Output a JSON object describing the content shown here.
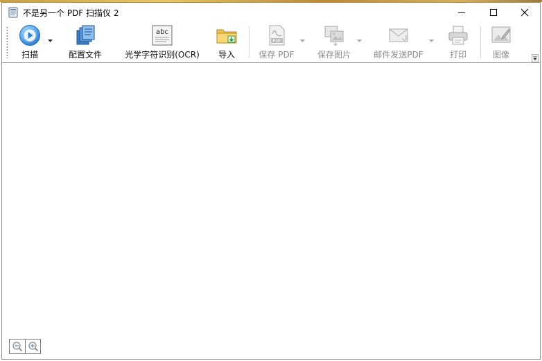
{
  "window": {
    "title": "不是另一个 PDF 扫描仪 2"
  },
  "toolbar": {
    "scan_label": "扫描",
    "profiles_label": "配置文件",
    "ocr_label": "光学字符识别(OCR)",
    "ocr_icon_text": "abc",
    "import_label": "导入",
    "save_pdf_label": "保存 PDF",
    "pdf_icon_text": "PDF",
    "save_image_label": "保存图片",
    "email_pdf_label": "邮件发送PDF",
    "print_label": "打印",
    "image_label": "图像"
  },
  "colors": {
    "scan_blue": "#3a8fe0",
    "disabled_gray": "#8a8a8a"
  }
}
